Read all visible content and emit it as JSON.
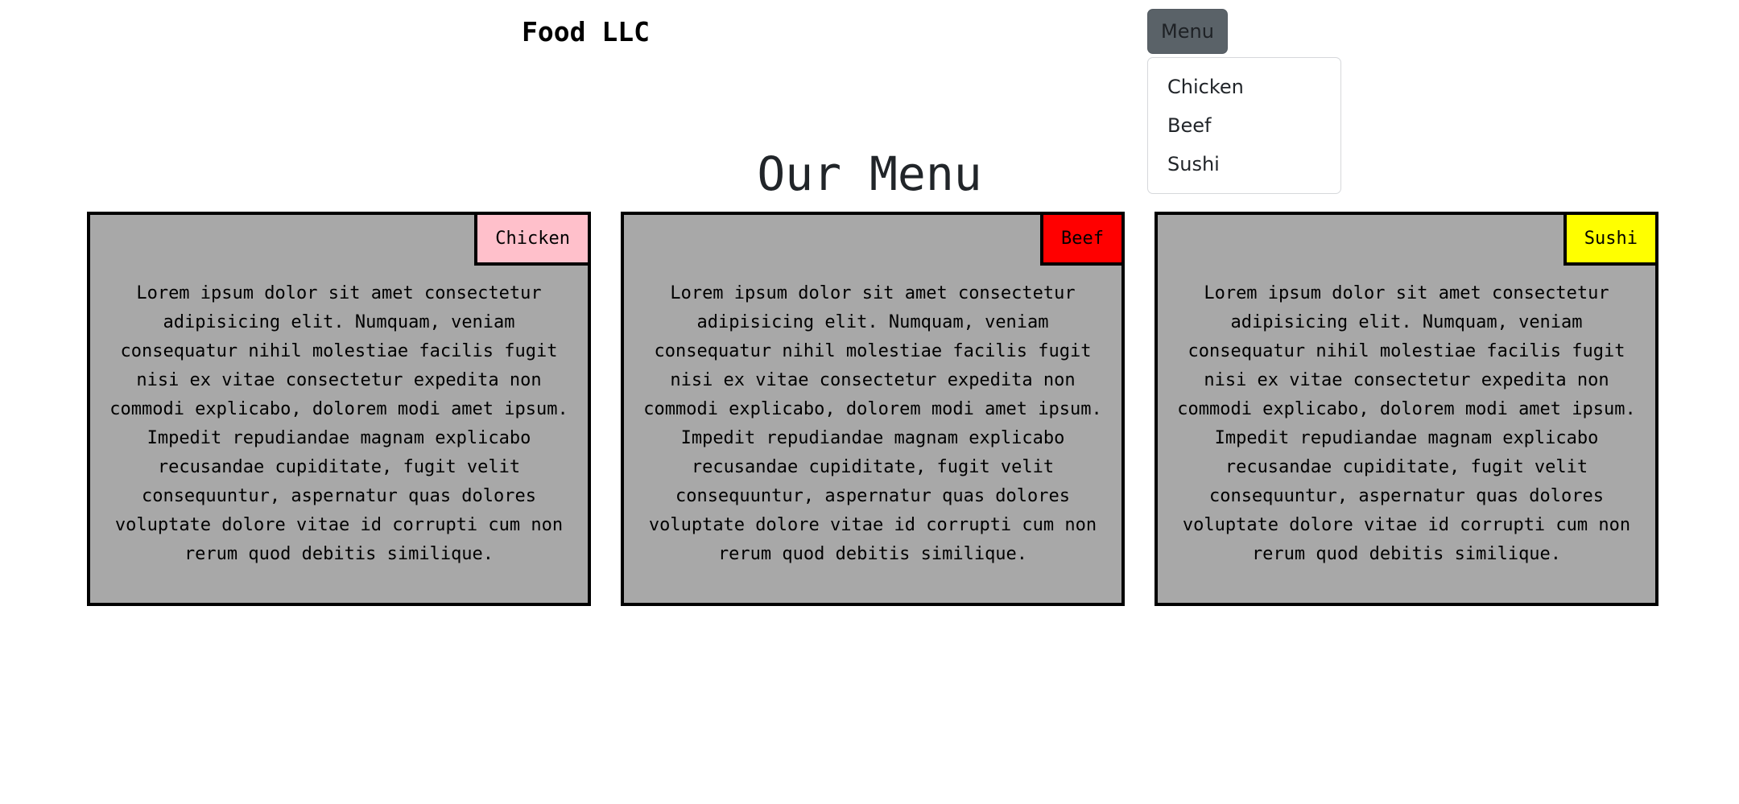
{
  "header": {
    "brand": "Food LLC",
    "menu_button_label": "Menu"
  },
  "dropdown": {
    "items": [
      {
        "label": "Chicken"
      },
      {
        "label": "Beef"
      },
      {
        "label": "Sushi"
      }
    ]
  },
  "page_title": "Our Menu",
  "cards": [
    {
      "tag": "Chicken",
      "tag_color": "#ffc0cb",
      "text": "Lorem ipsum dolor sit amet consectetur adipisicing elit. Numquam, veniam consequatur nihil molestiae facilis fugit nisi ex vitae consectetur expedita non commodi explicabo, dolorem modi amet ipsum. Impedit repudiandae magnam explicabo recusandae cupiditate, fugit velit consequuntur, aspernatur quas dolores voluptate dolore vitae id corrupti cum non rerum quod debitis similique."
    },
    {
      "tag": "Beef",
      "tag_color": "#ff0000",
      "text": "Lorem ipsum dolor sit amet consectetur adipisicing elit. Numquam, veniam consequatur nihil molestiae facilis fugit nisi ex vitae consectetur expedita non commodi explicabo, dolorem modi amet ipsum. Impedit repudiandae magnam explicabo recusandae cupiditate, fugit velit consequuntur, aspernatur quas dolores voluptate dolore vitae id corrupti cum non rerum quod debitis similique."
    },
    {
      "tag": "Sushi",
      "tag_color": "#ffff00",
      "text": "Lorem ipsum dolor sit amet consectetur adipisicing elit. Numquam, veniam consequatur nihil molestiae facilis fugit nisi ex vitae consectetur expedita non commodi explicabo, dolorem modi amet ipsum. Impedit repudiandae magnam explicabo recusandae cupiditate, fugit velit consequuntur, aspernatur quas dolores voluptate dolore vitae id corrupti cum non rerum quod debitis similique."
    }
  ]
}
